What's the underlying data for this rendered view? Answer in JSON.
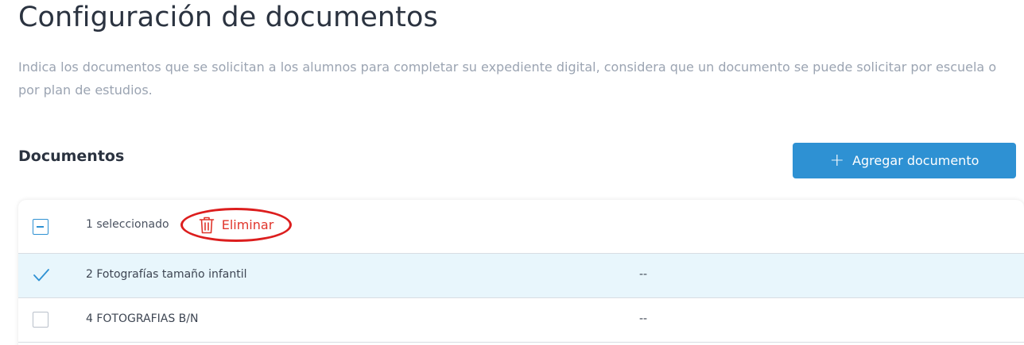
{
  "header": {
    "title": "Configuración de documentos",
    "description": "Indica los documentos que se solicitan a los alumnos para completar su expediente digital, considera que un documento se puede solicitar por escuela o por plan de estudios."
  },
  "section": {
    "title": "Documentos",
    "add_button_label": "Agregar documento",
    "add_button_icon": "plus-icon"
  },
  "table": {
    "selected_count_label": "1 seleccionado",
    "delete_label": "Eliminar",
    "delete_icon": "trash-icon",
    "rows": [
      {
        "name": "2 Fotografías tamaño infantil",
        "value": "--",
        "selected": true
      },
      {
        "name": "4 FOTOGRAFIAS B/N",
        "value": "--",
        "selected": false
      }
    ]
  },
  "colors": {
    "primary": "#2e91d3",
    "danger": "#e0352b",
    "highlight_ring": "#dc1e1e",
    "selected_row_bg": "#e8f6fc",
    "title_text": "#2b3340",
    "muted_text": "#9ba4b2"
  }
}
